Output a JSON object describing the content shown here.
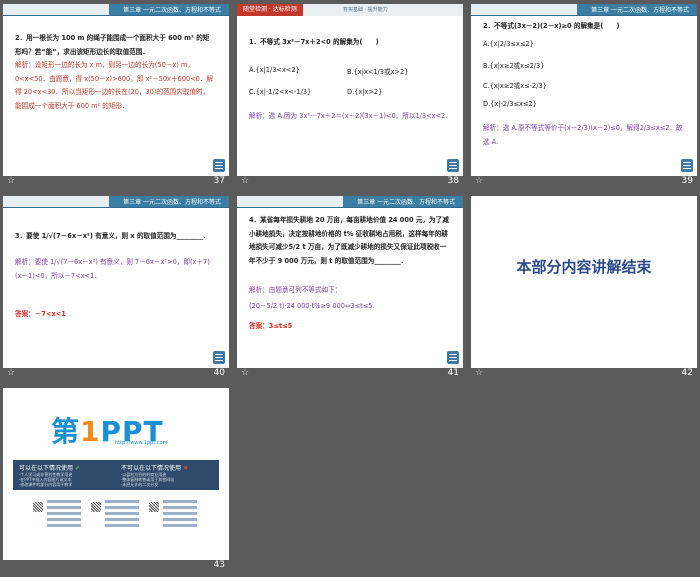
{
  "slides": [
    {
      "page": "37",
      "header": "第三章  一元二次函数、方程和不等式",
      "question": "2．用一根长为 100 m 的绳子能围成一个面积大于 600 m² 的矩形吗？若“能”，求出该矩形边长的取值范围．",
      "answer": "解析：设矩形一边的长为 x m，则另一边的长为(50－x) m，0<x<50．由题意，得 x(50－x)>600，即 x²－50x＋600<0．解得 20<x<30．所以当矩形一边的长在(20，30)的范围内取值时，能围成一个面积大于 600 m² 的矩形．"
    },
    {
      "page": "38",
      "header": "第三章  一元二次函数、方程和不等式",
      "tab1": "随堂检测 · 达标检测",
      "tab2": "夯实基础 · 提升能力",
      "question": "1．不等式 3x²－7x＋2<0 的解集为(　　)",
      "optA": "A.{x|1/3<x<2}",
      "optB": "B.{x|x<1/3或x>2}",
      "optC": "C.{x|-1/2<x<-1/3}",
      "optD": "D.{x|x>2}",
      "answer": "解析：选 A.因为 3x²－7x＋2＝(x－2)(3x－1)<0，所以1/3<x<2."
    },
    {
      "page": "39",
      "header": "第三章  一元二次函数、方程和不等式",
      "question": "2．不等式(3x－2)(2－x)≥0 的解集是(　　)",
      "optA": "A.{x|2/3≤x≤2}",
      "optB": "B.{x|x≥2或x≤2/3}",
      "optC": "C.{x|x≥2或x≤-2/3}",
      "optD": "D.{x|-2/3≤x≤2}",
      "answer": "解析：选 A.原不等式等价于(x－2/3)(x－2)≤0，解得2/3≤x≤2．故选 A."
    },
    {
      "page": "40",
      "header": "第三章  一元二次函数、方程和不等式",
      "question": "3．要使 1/√(7－6x－x²) 有意义，则 x 的取值范围为________．",
      "answer": "解析：要使 1/√(7－6x－x²) 有意义，则 7－6x－x²>0，即(x＋7)(x－1)<0，所以－7<x<1．",
      "result": "答案：－7<x<1"
    },
    {
      "page": "41",
      "header": "第三章  一元二次函数、方程和不等式",
      "question": "4．某省每年损失耕地 20 万亩，每亩耕地价值 24 000 元，为了减小耕地损失，决定按耕地价格的 t% 征收耕地占用税，这样每年的耕地损失可减少5/2 t 万亩，为了既减少耕地的损失又保证此项税收一年不少于 9 000 万元，则 t 的取值范围为________．",
      "answer": "解析：由题意可列不等式如下：",
      "formula": "(20－5/2 t)·24 000·t%≥9 000⇔3≤t≤5.",
      "result": "答案：3≤t≤5"
    },
    {
      "page": "42",
      "title": "本部分内容讲解结束"
    },
    {
      "page": "43",
      "logo": "第1PPT",
      "url": "http://www.1ppt.com",
      "can_use": "可以在以下情况使用",
      "cannot_use": "不可以在以下情况使用",
      "can_lines": [
        "·个人学习或非营利性教学用途",
        "·在PPT中插入内容图片或文本",
        "·修改课件的部分内容用于教学"
      ],
      "cannot_lines": [
        "·以盈利为目的的商业用途",
        "·整体复制转售或用于其他网站",
        "·未经允许的二次分发"
      ]
    }
  ],
  "colors": {
    "background": "#5b5b5b",
    "answer_red": "#c0392b",
    "answer_purple": "#7b3fa8",
    "header_blue": "#3b7ea1"
  },
  "icons": {
    "footer": "star-icon",
    "nav": "menu-nav-icon"
  }
}
